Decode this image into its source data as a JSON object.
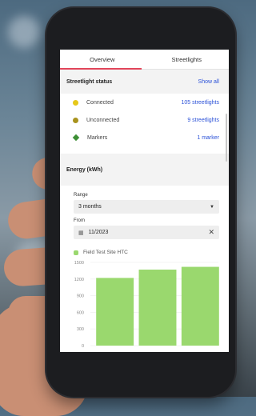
{
  "tabs": [
    {
      "label": "Overview",
      "active": true
    },
    {
      "label": "Streetlights",
      "active": false
    }
  ],
  "streetlight_status": {
    "title": "Streetlight status",
    "show_all": "Show all",
    "rows": [
      {
        "label": "Connected",
        "value": "105 streetlights",
        "icon": "yellow-dot-icon",
        "color": "#e6c81a"
      },
      {
        "label": "Unconnected",
        "value": "9 streetlights",
        "icon": "olive-dot-icon",
        "color": "#a8931e"
      },
      {
        "label": "Markers",
        "value": "1 marker",
        "icon": "green-diamond-icon",
        "color": "#3d8f35"
      }
    ]
  },
  "energy": {
    "title": "Energy (kWh)",
    "range_label": "Range",
    "range_value": "3 months",
    "from_label": "From",
    "from_value": "11/2023",
    "legend_label": "Field Test Site HTC",
    "legend_color": "#9ad86e"
  },
  "colors": {
    "accent": "#e2455a",
    "link": "#2c52d8",
    "bar": "#9ad86e"
  },
  "chart_data": {
    "type": "bar",
    "series": [
      {
        "name": "Field Test Site HTC",
        "values": [
          1220,
          1370,
          1420
        ]
      }
    ],
    "yticks": [
      "1500",
      "1200",
      "900",
      "600",
      "300",
      "0"
    ],
    "ylim": [
      0,
      1500
    ],
    "grid": true
  }
}
